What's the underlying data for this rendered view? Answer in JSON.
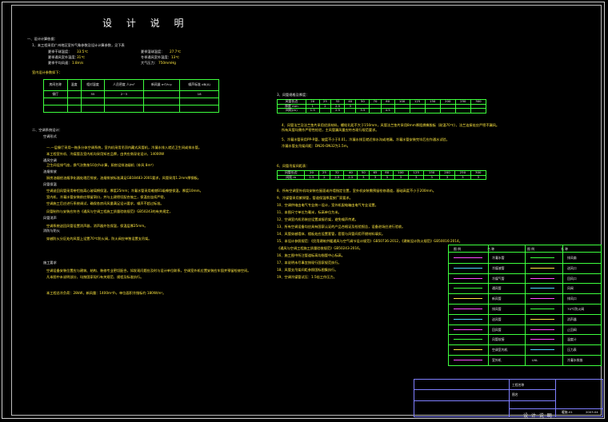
{
  "title": "设 计 说 明",
  "sections": {
    "one_heading": "一、设计计算依据：",
    "one_item": "1、本工程采用广州地区室外气象参数及设计计算参数，见下表",
    "summer_db": "夏季干球温度：",
    "summer_db_val": "33.5℃",
    "summer_wb": "夏季湿球温度：",
    "summer_wb_val": "27.7℃",
    "summer_out": "夏季通风室外温度：",
    "summer_out_val": "31℃",
    "winter_out": "冬季通风室外温度：",
    "winter_out_val": "13℃",
    "wind": "夏季平均风速：",
    "wind_val": "1.8m/s",
    "pressure": "大气压力：",
    "pressure_val": "750mmHg",
    "table_caption": "室内设计参数如下：",
    "two_heading": "二、空调系统设计：",
    "two_lines": [
      "空调形式",
      "一.一层餐厅采用一拖多分体空调系统，室内机采用吊顶内藏式风管机，冷凝水排入就近卫生间或排水管。",
      "本工程室外机、冷媒管及室内机均采用知名品牌，由供应商深化设计，14000W",
      "通风空调",
      "卫生间设排气扇，换气次数按10次/h计算，厨房设排油烟机（补风 8m³）",
      "油烟排放",
      "厨房油烟经油烟净化器处理后排放，油烟排放标准满足GB18483-2001要求，风管采用1.2mm厚钢板。",
      "风管保温",
      "空调送回风管采用带铝箔离心玻璃棉保温，厚度25mm；冷凝水管采用难燃B1级橡塑保温，厚度10mm。",
      "室内机、冷凝水管安装前应预留洞口，并与土建密切配合施工，保温应连续严密。",
      "空调施工后应进行系统调试，确保各房间风量满足设计要求，噪声不超过标准。",
      "风管制作与安装应符合《通风与空调工程施工质量验收规范》GB50243的有关规定，",
      "风管消声",
      "空调系统送回风管设置消声器，消声器外包保温，保温层厚25mm。",
      "消防与防火",
      "穿越防火分区处的风管上设置70℃防火阀，防火阀应单独设置支吊架。",
      "施工要求",
      "空调设备安装位置应与建筑、结构、装修专业密切配合，如发现问题应及时与设计单位联系，空调室外机位置安装应牢固并预留检修空间。",
      "凡本图中未说明部分，均按国家现行有关规范、规程及标准执行。",
      "本工程总冷负荷：28kW，新风量：1400m³/h，单位面积冷指标约 180W/m²。"
    ],
    "three_heading": "3、风管规格及厚度：",
    "right_lines": [
      "4、风管法兰及法兰垫片采用优质材料，螺栓孔距不大于150mm，风管法兰垫片采用8mm厚阻燃橡胶板（耐温70℃），法兰连接处应严密不漏风。",
      "   所有风管均需作严密性检验，主风管漏风量应符合现行规范要求。",
      "5、冷凝水管采用PP-R管，坡度不小于0.01，冷凝水排至就近排水沟或地漏，冷凝水管安装完毕后应作通水试验。",
      "   冷凝水管支吊架间距：DN20-DN32为1.5m。",
      "6、风管吊架间距表："
    ],
    "right_notes": [
      "8、所有空调室外机均安装在屋面或外墙指定位置，室外机安装需预留检修通道，基础高度不小于200mm。",
      "9、冷媒管采用紫铜管，管道保温厚度按厂家要求。",
      "10、空调供电由电气专业统一设计，室外机配电箱由电气专业设置。",
      "11、本图尺寸单位为毫米，标高单位为米。",
      "12、空调室内机吊装应设置减振吊架，避免噪声传递。",
      "13、所有空调设备均应具有国家认证的产品合格证及检验报告，设备进场应进行验收。",
      "14、风管穿越墙体、楼板处应设置套管，套管与风管间用不燃材料填实。",
      "15、本设计参照规范：《民用建筑供暖通风与空气调节设计规范》GB50736-2012，《建筑设计防火规范》GB50016-2014。",
      "    《通风与空调工程施工质量验收规范》GB50243-2016。",
      "16、施工图中所注管道标高均指管中心标高。",
      "17、本说明未尽事宜按现行国家规范执行。",
      "18、风管支吊架间距参照国标图集执行。",
      "19、空调冷媒管试压：1.5倍工作压力。"
    ]
  },
  "indoor_table": {
    "headers": [
      "房间名称",
      "温度",
      "相对湿度",
      "人员密度 人/m²",
      "新风量 m³/h·p",
      "噪声标准 dB(A)"
    ],
    "rows": [
      [
        "餐厅",
        "",
        "55",
        "2~3",
        "",
        "18"
      ],
      [
        "",
        "",
        "",
        "",
        "",
        ""
      ],
      [
        "",
        "",
        "",
        "",
        "",
        ""
      ]
    ]
  },
  "duct_table": {
    "row1": [
      "风管长边",
      "20",
      "25",
      "32",
      "40",
      "50",
      "70",
      "80",
      "100",
      "125",
      "150",
      "200",
      "250",
      "300"
    ],
    "row2": [
      "厚度 mm",
      "1",
      "2",
      "2.5",
      "3",
      "",
      "",
      "",
      "",
      "",
      "",
      "",
      "",
      ""
    ],
    "row3": [
      "间距(m)",
      "1.5",
      "",
      "2.5",
      "",
      "3.5",
      "",
      "4.5",
      "",
      "",
      "",
      "",
      "",
      ""
    ]
  },
  "hanger_table": {
    "row1": [
      "风管长边",
      "20",
      "25",
      "32",
      "40",
      "50",
      "65",
      "80",
      "100",
      "125",
      "150",
      "200",
      "250",
      "300"
    ],
    "row2": [
      "间距 m",
      "1.5",
      "2",
      "2.5",
      "2.5",
      "3",
      "3",
      "3",
      "3",
      "3",
      "3",
      "3",
      "3",
      "3"
    ]
  },
  "legend": {
    "header": [
      "图 例",
      "名 称",
      "图 例",
      "名 称"
    ],
    "rows": [
      [
        "",
        "冷凝水管",
        "",
        "排风扇"
      ],
      [
        "",
        "冷媒液管",
        "",
        "送风口"
      ],
      [
        "",
        "冷媒气管",
        "",
        "回风口"
      ],
      [
        "",
        "通风管",
        "",
        "风阀"
      ],
      [
        "",
        "新风管",
        "",
        "排风口"
      ],
      [
        "",
        "排风管",
        "",
        "70℃防火阀"
      ],
      [
        "",
        "送风管",
        "",
        "消声器"
      ],
      [
        "",
        "回风管",
        "",
        "止回阀"
      ],
      [
        "",
        "风管软接",
        "",
        "温度计"
      ],
      [
        "",
        "空调室内机",
        "",
        "压力表"
      ],
      [
        "",
        "室外机",
        "LNL",
        "冷凝水排放"
      ]
    ]
  },
  "title_block": {
    "label_project": "工程名称",
    "label_drawing": "图名",
    "drawing_name": "设 计 说 明",
    "date": "2003.04",
    "sheet": "暖施-01"
  },
  "colors": {
    "green": "#3dff3d",
    "white": "#e8e8e8",
    "yellow": "#ffe840",
    "magenta": "#ff4dff",
    "blue": "#7f7fff"
  }
}
